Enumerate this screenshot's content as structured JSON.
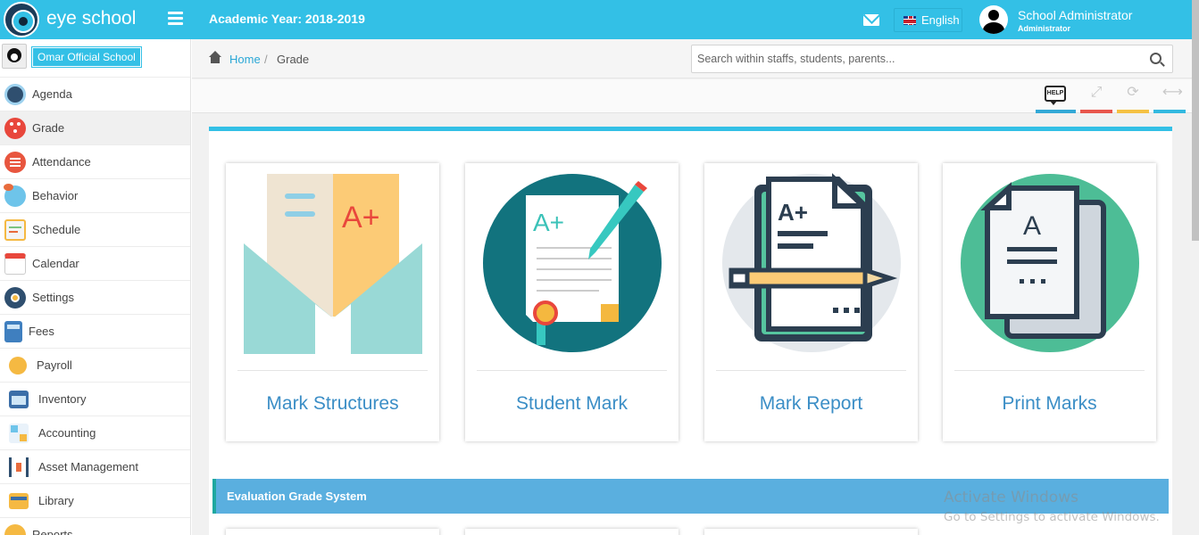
{
  "header": {
    "brand": "eye school",
    "academic_year": "Academic Year: 2018-2019",
    "language": "English",
    "user_name": "School Administrator",
    "user_role": "Administrator"
  },
  "sidebar": {
    "school_name": "Omar Official School",
    "items": [
      {
        "label": "Agenda",
        "icon": "agenda-icon"
      },
      {
        "label": "Grade",
        "icon": "grade-icon",
        "active": true
      },
      {
        "label": "Attendance",
        "icon": "attendance-icon"
      },
      {
        "label": "Behavior",
        "icon": "behavior-icon"
      },
      {
        "label": "Schedule",
        "icon": "schedule-icon"
      },
      {
        "label": "Calendar",
        "icon": "calendar-icon"
      },
      {
        "label": "Settings",
        "icon": "settings-icon"
      },
      {
        "label": "Fees",
        "icon": "fees-icon"
      },
      {
        "label": "Payroll",
        "icon": "payroll-icon"
      },
      {
        "label": "Inventory",
        "icon": "inventory-icon"
      },
      {
        "label": "Accounting",
        "icon": "accounting-icon"
      },
      {
        "label": "Asset Management",
        "icon": "asset-management-icon"
      },
      {
        "label": "Library",
        "icon": "library-icon"
      },
      {
        "label": "Reports",
        "icon": "reports-icon"
      }
    ]
  },
  "breadcrumb": {
    "home": "Home",
    "separator": "/",
    "current": "Grade"
  },
  "search": {
    "placeholder": "Search within staffs, students, parents..."
  },
  "toolbar": {
    "help": "HELP"
  },
  "cards": [
    {
      "label": "Mark Structures",
      "icon": "mark-structures-icon"
    },
    {
      "label": "Student Mark",
      "icon": "student-mark-icon"
    },
    {
      "label": "Mark Report",
      "icon": "mark-report-icon"
    },
    {
      "label": "Print Marks",
      "icon": "print-marks-icon"
    }
  ],
  "section": {
    "title": "Evaluation Grade System"
  },
  "watermark": {
    "line1": "Activate Windows",
    "line2": "Go to Settings to activate Windows."
  },
  "colors": {
    "primary": "#33c0e6",
    "link": "#3b8ec6",
    "section": "#5aafdf"
  }
}
